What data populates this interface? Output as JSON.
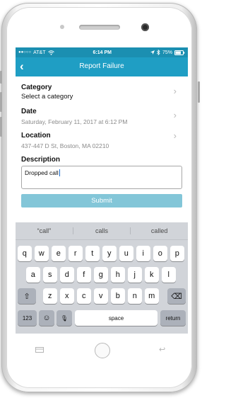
{
  "status_bar": {
    "signal": "●●○○○",
    "carrier": "AT&T",
    "time": "6:14 PM",
    "location_icon": "location-arrow-icon",
    "bluetooth_icon": "bluetooth-icon",
    "battery": "75%"
  },
  "nav": {
    "back_glyph": "‹",
    "title": "Report Failure"
  },
  "form": {
    "category": {
      "label": "Category",
      "value": "Select a category"
    },
    "date": {
      "label": "Date",
      "value": "Saturday, February 11, 2017 at 6:12 PM"
    },
    "location": {
      "label": "Location",
      "value": "437-447 D St, Boston, MA  02210"
    },
    "description": {
      "label": "Description",
      "value": "Dropped call"
    },
    "submit_label": "Submit",
    "submit_color": "#83c6d8",
    "chevron": "›"
  },
  "keyboard": {
    "suggestions": [
      "“call”",
      "calls",
      "called"
    ],
    "row1": [
      "q",
      "w",
      "e",
      "r",
      "t",
      "y",
      "u",
      "i",
      "o",
      "p"
    ],
    "row2": [
      "a",
      "s",
      "d",
      "f",
      "g",
      "h",
      "j",
      "k",
      "l"
    ],
    "row3": [
      "z",
      "x",
      "c",
      "v",
      "b",
      "n",
      "m"
    ],
    "shift_glyph": "⇧",
    "delete_glyph": "⌫",
    "numbers_label": "123",
    "emoji_glyph": "☺",
    "mic_glyph": "🎙",
    "space_label": "space",
    "return_label": "return"
  },
  "colors": {
    "nav_bar": "#1f9ec4",
    "status_bar": "#1b8fb1",
    "keyboard_bg": "#d1d4d9"
  }
}
